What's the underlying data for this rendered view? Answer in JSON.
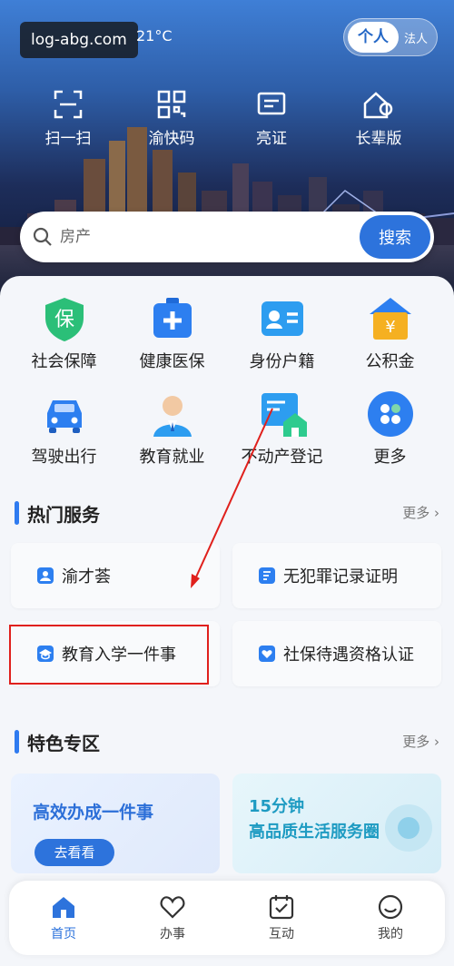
{
  "status_bar": {
    "watermark": "log-abg.com",
    "weather": "21°C"
  },
  "mode_toggle": {
    "personal": "个人",
    "legal": "法人"
  },
  "quick_actions": [
    {
      "label": "扫一扫",
      "icon": "scan-icon"
    },
    {
      "label": "渝快码",
      "icon": "qr-code-icon"
    },
    {
      "label": "亮证",
      "icon": "certificate-icon"
    },
    {
      "label": "长辈版",
      "icon": "elder-mode-icon"
    }
  ],
  "search": {
    "placeholder": "房产",
    "button": "搜索"
  },
  "services": [
    {
      "label": "社会保障",
      "icon": "social-security-icon",
      "color": "#2bbf78"
    },
    {
      "label": "健康医保",
      "icon": "medical-insurance-icon",
      "color": "#2d7ff0"
    },
    {
      "label": "身份户籍",
      "icon": "id-card-icon",
      "color": "#2d9df0"
    },
    {
      "label": "公积金",
      "icon": "housing-fund-icon",
      "color": "#f5b021"
    },
    {
      "label": "驾驶出行",
      "icon": "car-icon",
      "color": "#2d7ff0"
    },
    {
      "label": "教育就业",
      "icon": "graduate-icon",
      "color": "#2d9df0"
    },
    {
      "label": "不动产登记",
      "icon": "property-icon",
      "color": "#2ab7c8"
    },
    {
      "label": "更多",
      "icon": "more-apps-icon",
      "color": "#2d7ff0"
    }
  ],
  "hot_services": {
    "title": "热门服务",
    "more": "更多",
    "items": [
      {
        "label": "渝才荟"
      },
      {
        "label": "无犯罪记录证明"
      },
      {
        "label": "教育入学一件事"
      },
      {
        "label": "社保待遇资格认证"
      }
    ]
  },
  "featured": {
    "title": "特色专区",
    "more": "更多",
    "left": {
      "title": "高效办成一件事",
      "button": "去看看"
    },
    "right": {
      "line1": "15分钟",
      "line2": "高品质生活服务圈"
    }
  },
  "bottom_nav": [
    {
      "label": "首页",
      "active": true
    },
    {
      "label": "办事",
      "active": false
    },
    {
      "label": "互动",
      "active": false
    },
    {
      "label": "我的",
      "active": false
    }
  ],
  "colors": {
    "accent": "#2d73dc",
    "highlight": "#e0201c"
  }
}
